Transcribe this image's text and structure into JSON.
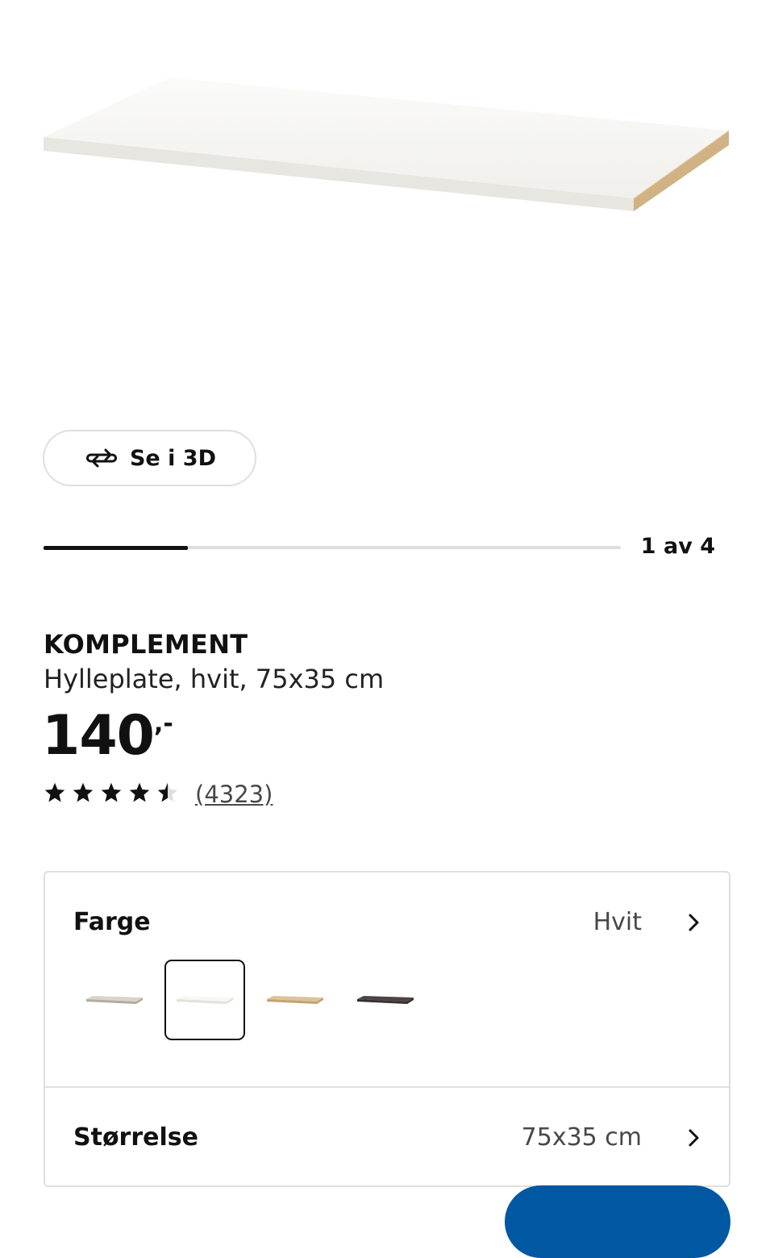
{
  "product_image": {
    "icon": "shelf-board-image"
  },
  "view_3d": {
    "label": "Se i 3D",
    "icon": "rotate-3d-icon"
  },
  "gallery": {
    "counter": "1 av 4",
    "progress": 0.25
  },
  "product": {
    "brand": "KOMPLEMENT",
    "description": "Hylleplate, hvit, 75x35 cm",
    "price": "140",
    "price_suffix": ",-",
    "rating": 4.5,
    "rating_max": 5,
    "review_count": "(4323)"
  },
  "options": {
    "color": {
      "label": "Farge",
      "value": "Hvit",
      "swatches": [
        {
          "name": "beige",
          "top": "#d9d4cc",
          "edge": "#b4ab9f",
          "selected": false
        },
        {
          "name": "white",
          "top": "#f7f7f4",
          "edge": "#e3e1dc",
          "selected": true
        },
        {
          "name": "oak",
          "top": "#dcc39a",
          "edge": "#c2a274",
          "selected": false
        },
        {
          "name": "black-brown",
          "top": "#4b4442",
          "edge": "#363131",
          "selected": false
        }
      ]
    },
    "size": {
      "label": "Størrelse",
      "value": "75x35 cm"
    }
  },
  "colors": {
    "accent": "#0058a3",
    "border": "#dfdfdf",
    "text": "#111111",
    "muted": "#484848"
  }
}
